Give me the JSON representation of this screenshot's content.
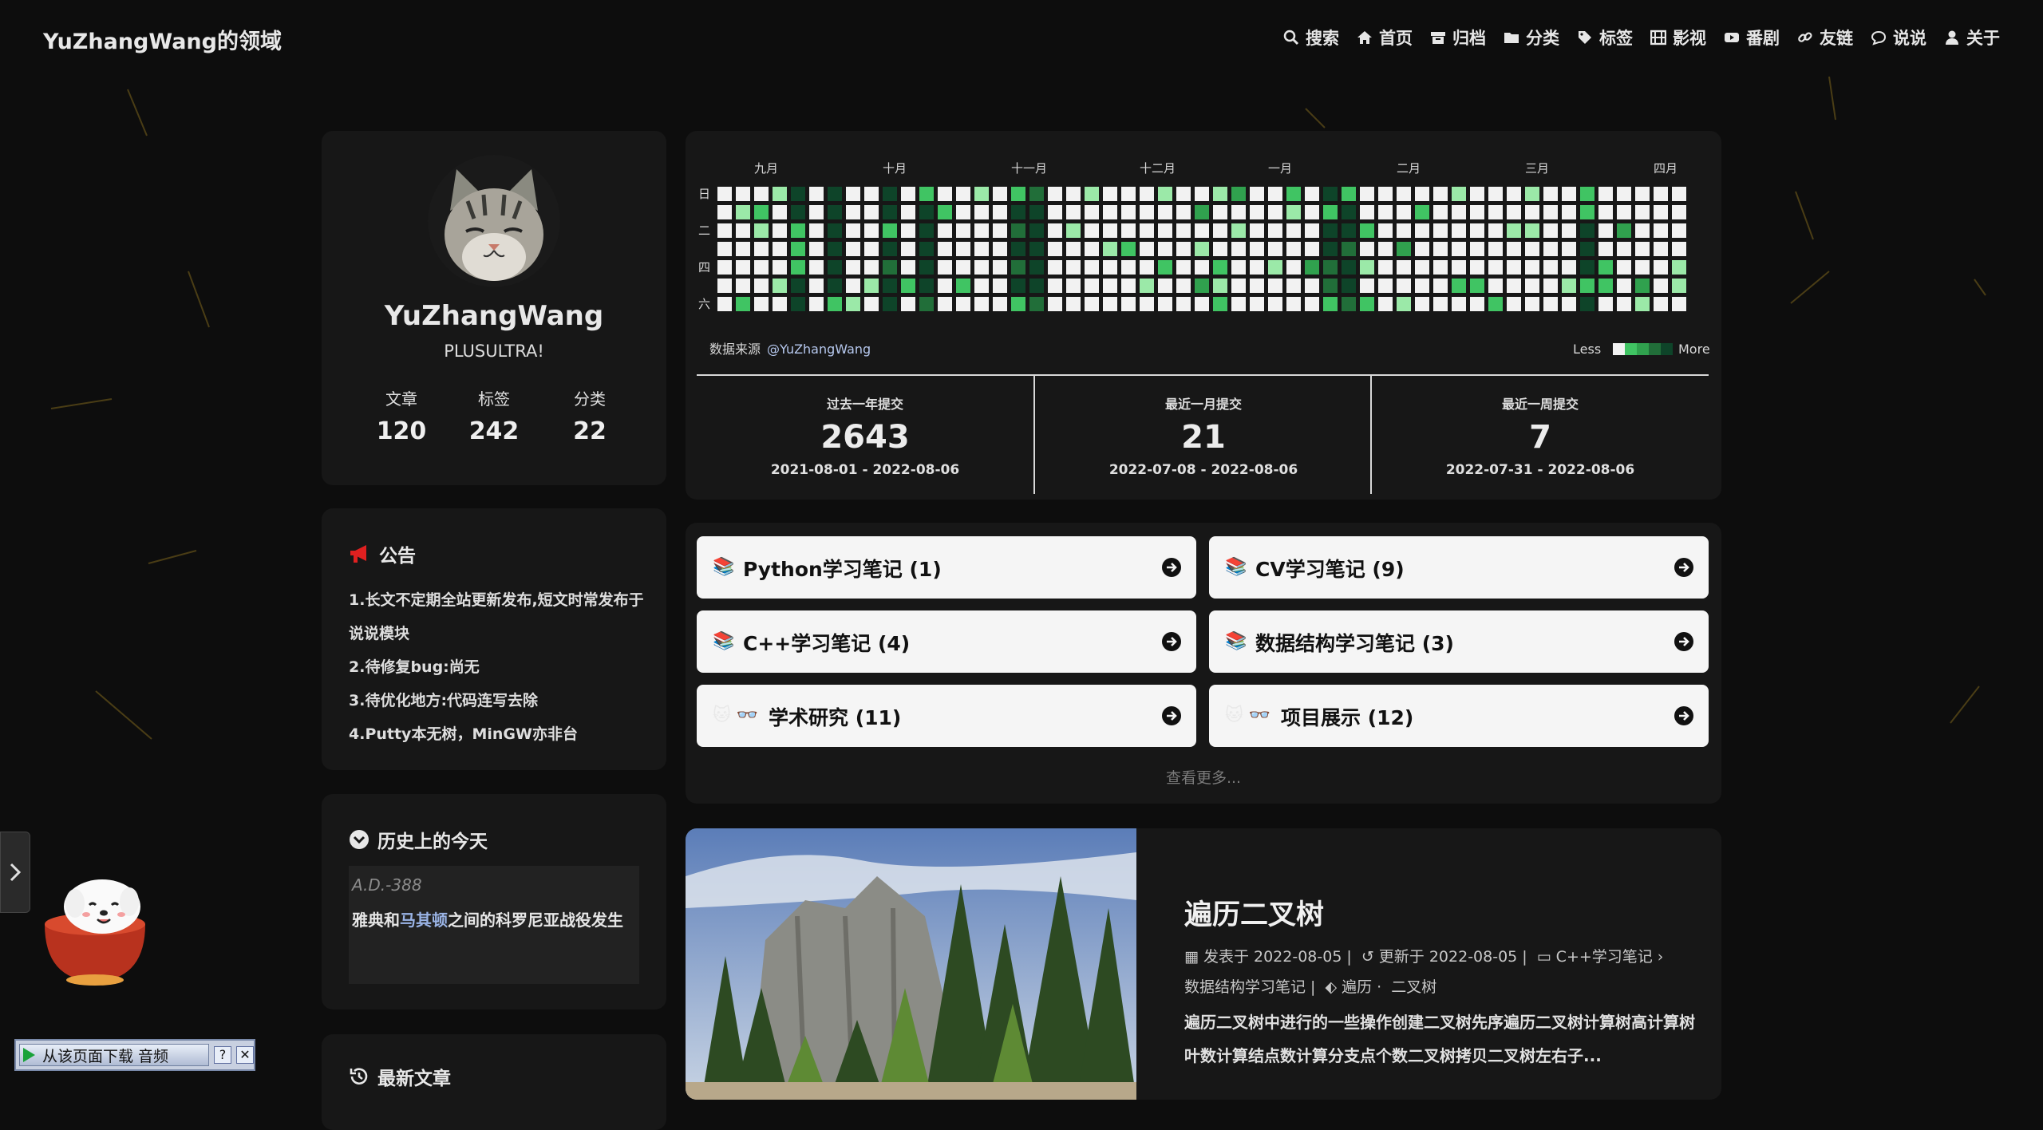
{
  "site": {
    "name": "YuZhangWang的领域"
  },
  "menu": [
    {
      "icon": "search-icon",
      "label": "搜索"
    },
    {
      "icon": "home-icon",
      "label": "首页"
    },
    {
      "icon": "archive-icon",
      "label": "归档"
    },
    {
      "icon": "folder-icon",
      "label": "分类"
    },
    {
      "icon": "tag-icon",
      "label": "标签"
    },
    {
      "icon": "film-icon",
      "label": "影视"
    },
    {
      "icon": "video-icon",
      "label": "番剧"
    },
    {
      "icon": "link-icon",
      "label": "友链"
    },
    {
      "icon": "comment-icon",
      "label": "说说"
    },
    {
      "icon": "user-icon",
      "label": "关于"
    }
  ],
  "author": {
    "name": "YuZhangWang",
    "description": "PLUSULTRA!",
    "stats": [
      {
        "label": "文章",
        "value": "120"
      },
      {
        "label": "标签",
        "value": "242"
      },
      {
        "label": "分类",
        "value": "22"
      }
    ]
  },
  "announcement": {
    "title": "公告",
    "lines": [
      "1.长文不定期全站更新发布,短文时常发布于说说模块",
      "2.待修复bug:尚无",
      "3.待优化地方:代码连写去除",
      "4.Putty本无树，MinGW亦非台"
    ]
  },
  "history": {
    "title": "历史上的今天",
    "year": "A.D.-388",
    "event_pre": "雅典和",
    "event_link": "马其顿",
    "event_post": "之间的科罗尼亚战役发生"
  },
  "recent": {
    "title": "最新文章"
  },
  "calendar": {
    "months": [
      "九月",
      "十月",
      "十一月",
      "十二月",
      "一月",
      "二月",
      "三月",
      "四月"
    ],
    "weekdays": [
      "日",
      "二",
      "四",
      "六"
    ],
    "source_label": "数据来源",
    "source_user": "@YuZhangWang",
    "less": "Less",
    "more": "More",
    "colors": [
      "#f2f2f2",
      "#9be9a8",
      "#40c463",
      "#30a14e",
      "#216e39",
      "#0e4429"
    ],
    "stats": [
      {
        "title": "过去一年提交",
        "value": "2643",
        "range": "2021-08-01 - 2022-08-06"
      },
      {
        "title": "最近一月提交",
        "value": "21",
        "range": "2022-07-08 - 2022-08-06"
      },
      {
        "title": "最近一周提交",
        "value": "7",
        "range": "2022-07-31 - 2022-08-06"
      }
    ]
  },
  "categories": {
    "items": [
      {
        "icon": "books-icon",
        "emoji": "📚",
        "label": "Python学习笔记 (1)"
      },
      {
        "icon": "books-icon",
        "emoji": "📚",
        "label": "CV学习笔记 (9)"
      },
      {
        "icon": "books-icon",
        "emoji": "📚",
        "label": "C++学习笔记 (4)"
      },
      {
        "icon": "books-icon",
        "emoji": "📚",
        "label": "数据结构学习笔记 (3)"
      },
      {
        "icon": "cat-glasses-icon",
        "emoji": "🐱 👓",
        "label": "学术研究 (11)"
      },
      {
        "icon": "cat-glasses-icon",
        "emoji": "🐱 👓",
        "label": "项目展示 (12)"
      }
    ],
    "more": "查看更多..."
  },
  "post": {
    "title": "遍历二叉树",
    "published": "发表于 2022-08-05",
    "updated": "更新于 2022-08-05",
    "category": "C++学习笔记",
    "category2": "数据结构学习笔记",
    "tag1": "遍历",
    "tag2": "二叉树",
    "excerpt": "遍历二叉树中进行的一些操作创建二叉树先序遍历二叉树计算树高计算树叶数计算结点数计算分支点个数二叉树拷贝二叉树左右子..."
  },
  "download_bar": {
    "label": "从该页面下载 音频",
    "help": "?",
    "close": "✕"
  }
}
